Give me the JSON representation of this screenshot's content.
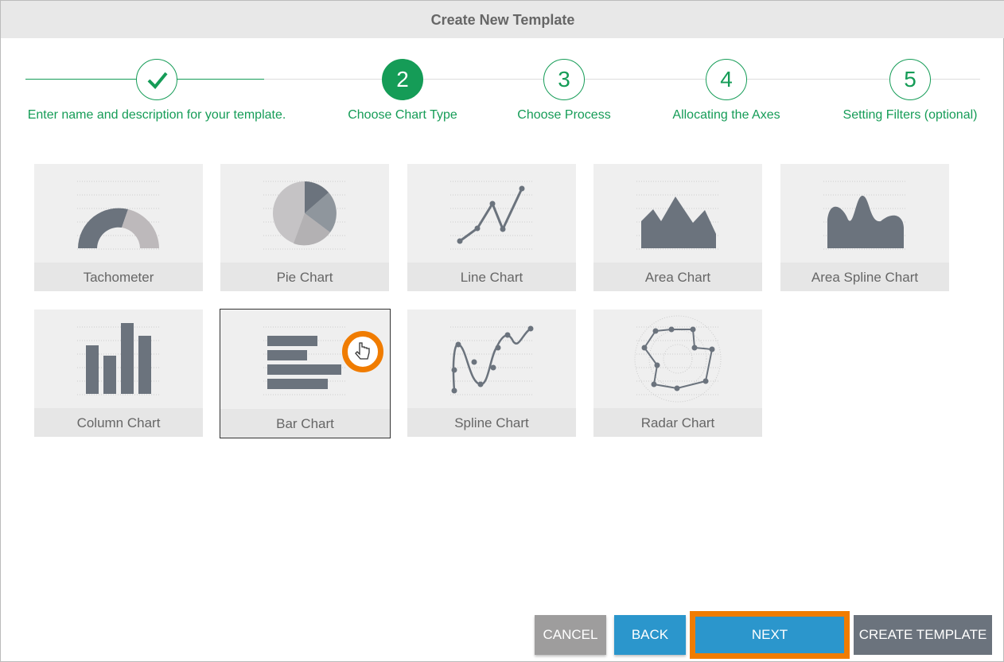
{
  "header": {
    "title": "Create New Template"
  },
  "steps": [
    {
      "number": "✓",
      "label": "Enter name and description for your template.",
      "state": "done"
    },
    {
      "number": "2",
      "label": "Choose Chart Type",
      "state": "active"
    },
    {
      "number": "3",
      "label": "Choose Process",
      "state": "pending"
    },
    {
      "number": "4",
      "label": "Allocating the Axes",
      "state": "pending"
    },
    {
      "number": "5",
      "label": "Setting Filters (optional)",
      "state": "pending"
    }
  ],
  "chart_types": [
    {
      "label": "Tachometer"
    },
    {
      "label": "Pie Chart"
    },
    {
      "label": "Line Chart"
    },
    {
      "label": "Area Chart"
    },
    {
      "label": "Area Spline Chart"
    },
    {
      "label": "Column Chart"
    },
    {
      "label": "Bar Chart",
      "selected": true
    },
    {
      "label": "Spline Chart"
    },
    {
      "label": "Radar Chart"
    }
  ],
  "buttons": {
    "cancel": "CANCEL",
    "back": "BACK",
    "next": "NEXT",
    "create": "CREATE TEMPLATE"
  },
  "colors": {
    "accent": "#159c57",
    "primary": "#2b96cc",
    "highlight": "#f07c00",
    "icon": "#6b737d"
  }
}
